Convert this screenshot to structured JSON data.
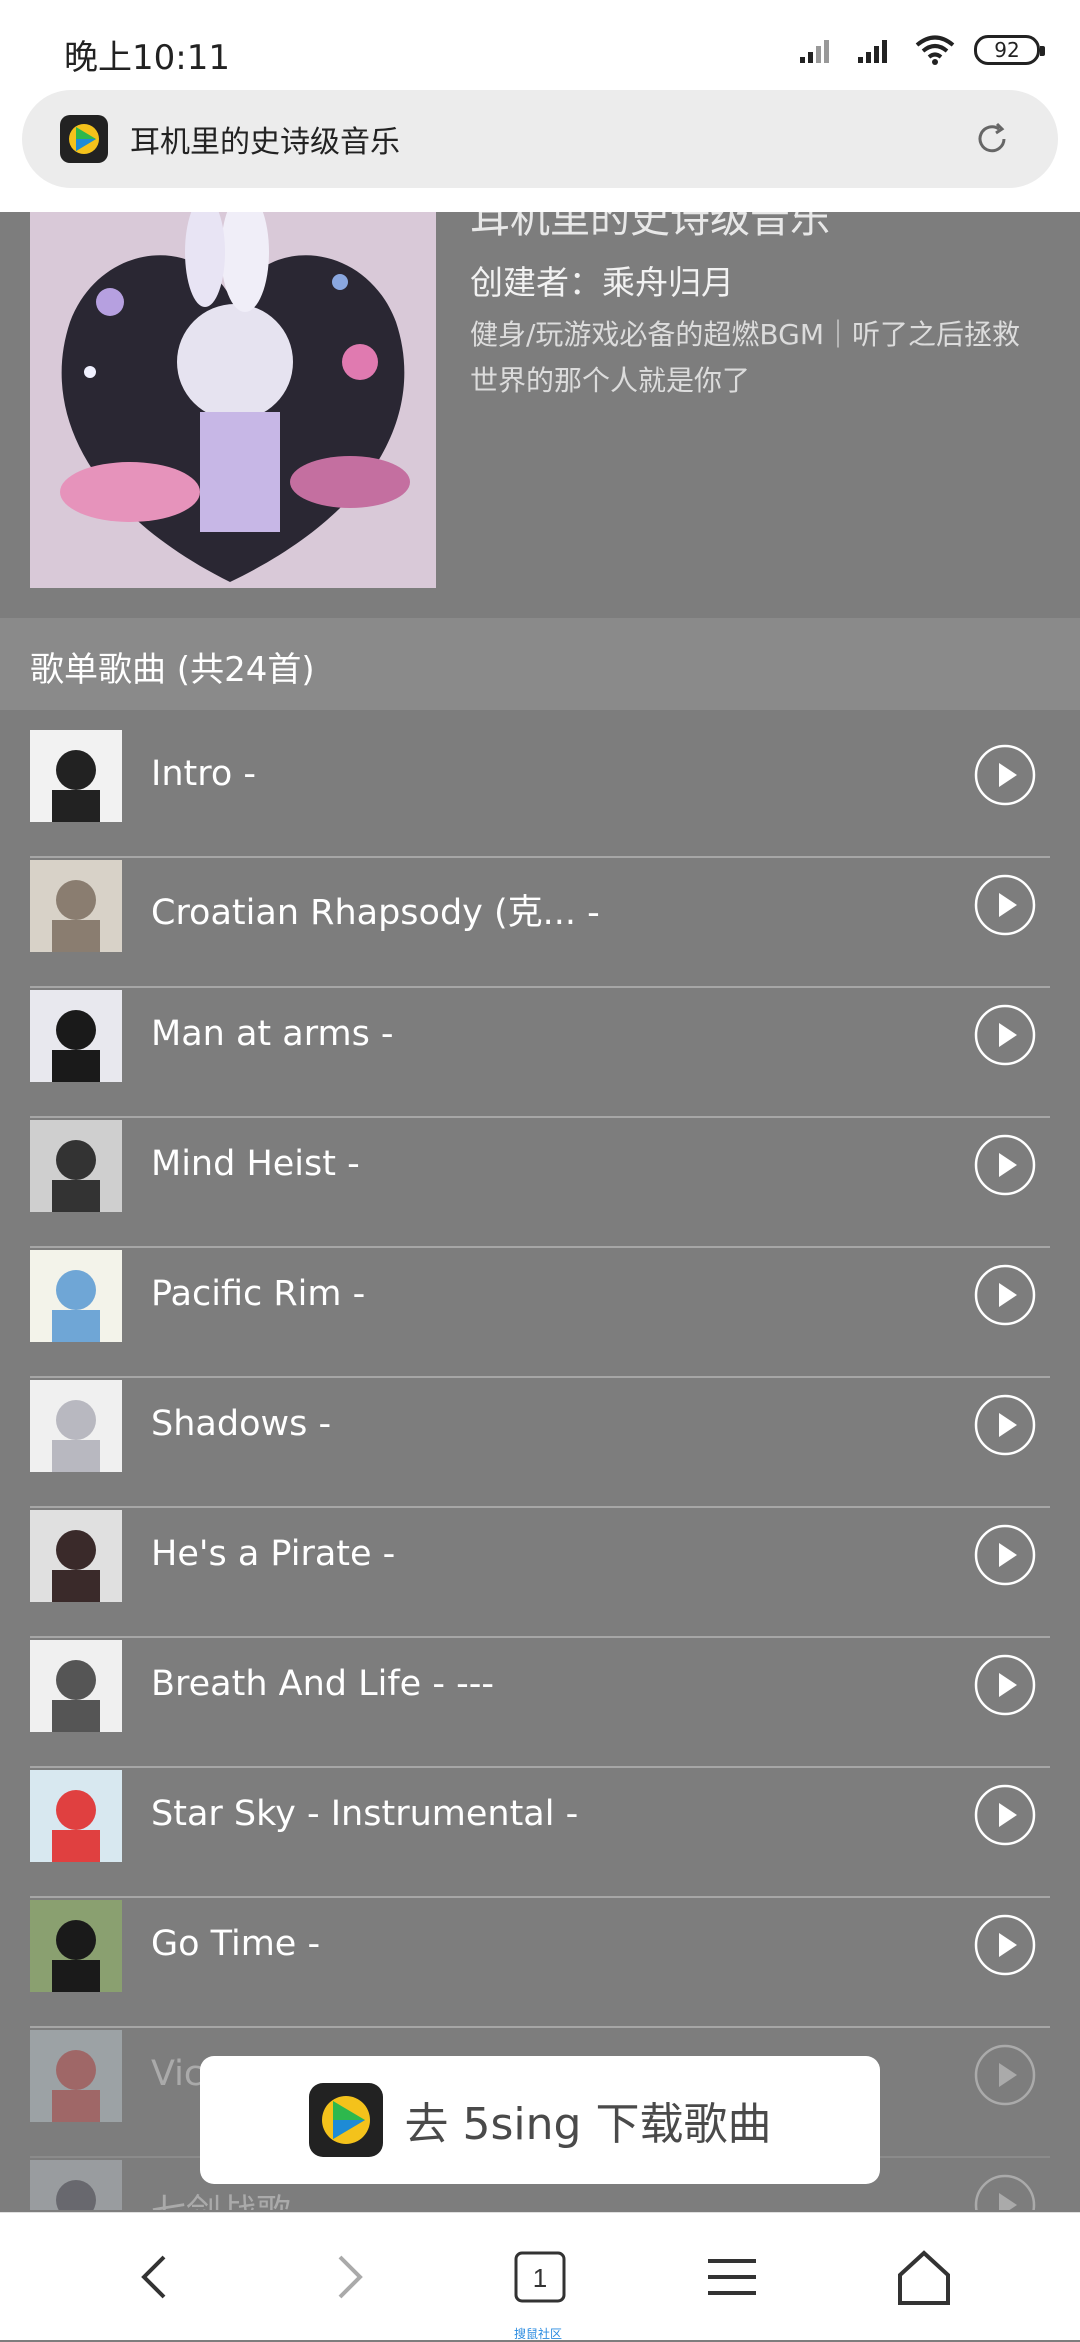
{
  "status": {
    "time": "晚上10:11",
    "battery": "92"
  },
  "urlbar": {
    "title": "耳机里的史诗级音乐"
  },
  "album": {
    "title": "耳机里的史诗级音乐",
    "creator": "创建者：乘舟归月",
    "description": "健身/玩游戏必备的超燃BGM｜听了之后拯救世界的那个人就是你了"
  },
  "songs_header": "歌单歌曲 (共24首)",
  "songs": [
    {
      "name": "Intro -"
    },
    {
      "name": "Croatian Rhapsody (克...     -"
    },
    {
      "name": "Man at arms -"
    },
    {
      "name": "Mind Heist -"
    },
    {
      "name": "Pacific Rim -"
    },
    {
      "name": "Shadows -"
    },
    {
      "name": "He's a Pirate -"
    },
    {
      "name": "Breath And Life - ---"
    },
    {
      "name": "Star Sky - Instrumental -"
    },
    {
      "name": "Go Time -"
    },
    {
      "name": "Vic"
    },
    {
      "name": "七剑战歌 -"
    }
  ],
  "banner": {
    "label": "去 5sing 下载歌曲"
  },
  "nav": {
    "tab_count": "1",
    "caption": "搜鼠社区"
  },
  "colors": {
    "brand_green": "#2db84d",
    "overlay_gray": "#7d7d7d"
  }
}
